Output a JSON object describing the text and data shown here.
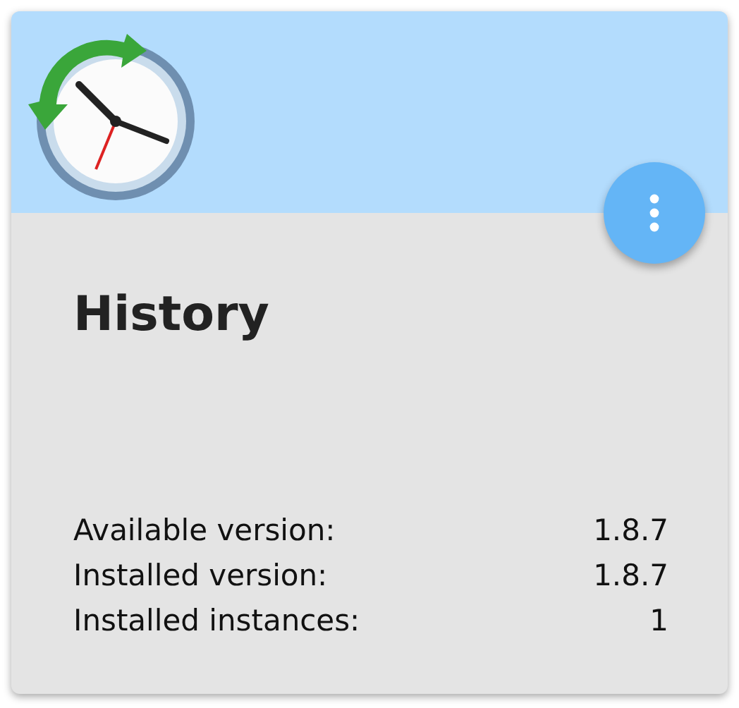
{
  "card": {
    "title": "History",
    "info": [
      {
        "label": "Available version:",
        "value": "1.8.7"
      },
      {
        "label": "Installed version:",
        "value": "1.8.7"
      },
      {
        "label": "Installed instances:",
        "value": "1"
      }
    ]
  }
}
